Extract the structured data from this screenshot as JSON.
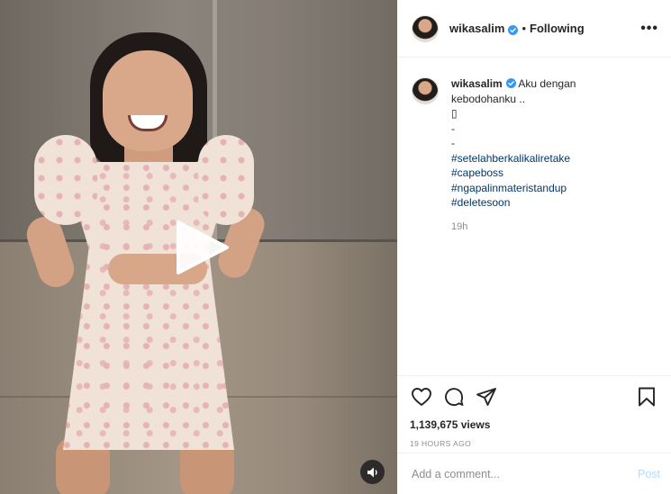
{
  "post": {
    "username": "wikasalim",
    "follow_state": "Following",
    "separator": "•",
    "more_label": "•••",
    "caption_lines": [
      "Aku dengan",
      "kebodohanku ..",
      "▯",
      "-",
      "-"
    ],
    "hashtags": [
      "#setelahberkalikaliretake",
      "#capeboss",
      "#ngapalinmateristandup",
      "#deletesoon"
    ],
    "caption_time": "19h",
    "views": "1,139,675 views",
    "timestamp": "19 HOURS AGO"
  },
  "comment": {
    "placeholder": "Add a comment...",
    "post_label": "Post"
  },
  "icons": {
    "like": "heart-icon",
    "comment": "comment-icon",
    "share": "share-icon",
    "save": "bookmark-icon",
    "play": "play-icon",
    "sound": "speaker-icon",
    "verified": "verified-badge-icon",
    "more": "more-options-icon"
  },
  "colors": {
    "verified": "#3897f0",
    "hashtag": "#00376b",
    "muted": "#8e8e8e",
    "post_disabled": "#b3dbff"
  }
}
